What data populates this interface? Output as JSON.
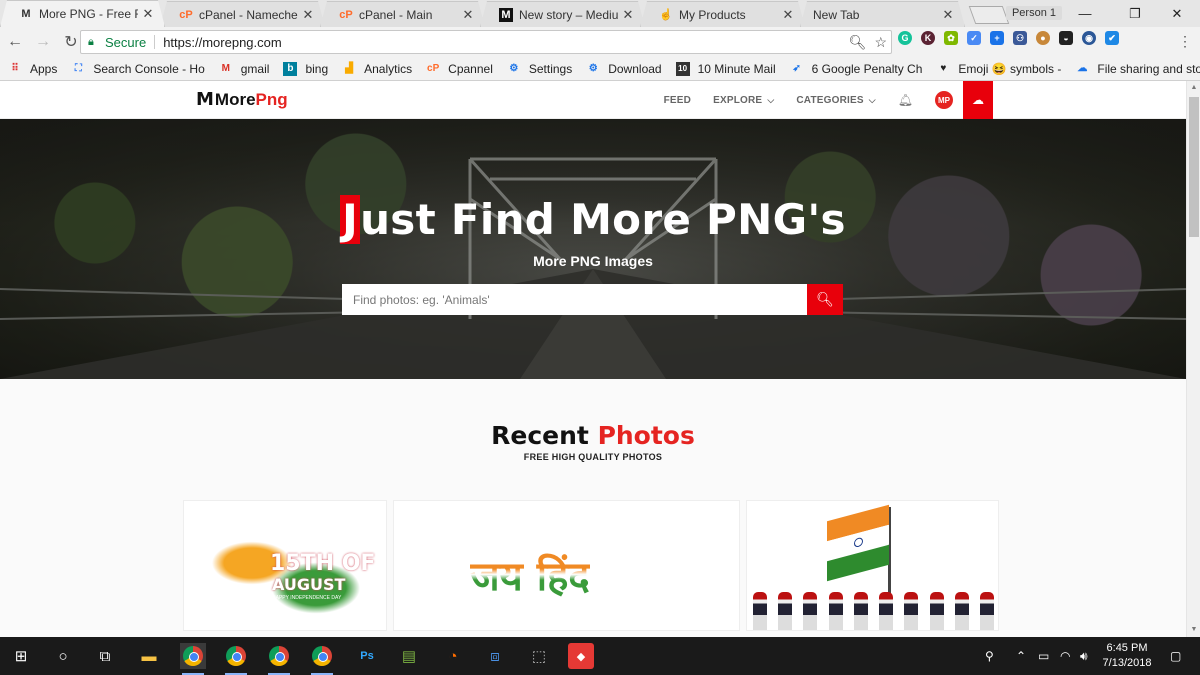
{
  "browser": {
    "tabs": [
      {
        "title": "More PNG - Free Full H",
        "favicon": "morepng-m-icon",
        "active": true
      },
      {
        "title": "cPanel - Namecheap SS",
        "favicon": "cpanel-icon",
        "active": false
      },
      {
        "title": "cPanel - Main",
        "favicon": "cpanel-icon",
        "active": false
      },
      {
        "title": "New story – Medium",
        "favicon": "medium-icon",
        "active": false
      },
      {
        "title": "My Products",
        "favicon": "hand-icon",
        "active": false
      },
      {
        "title": "New Tab",
        "favicon": "",
        "active": false
      }
    ],
    "profile": "Person 1",
    "secure_label": "Secure",
    "url": "https://morepng.com",
    "bookmarks": [
      {
        "label": "Apps",
        "icon": "apps-grid-icon"
      },
      {
        "label": "Search Console - Ho",
        "icon": "search-console-icon"
      },
      {
        "label": "gmail",
        "icon": "gmail-icon"
      },
      {
        "label": "bing",
        "icon": "bing-icon"
      },
      {
        "label": "Analytics",
        "icon": "analytics-icon"
      },
      {
        "label": "Cpannel",
        "icon": "cpanel-icon"
      },
      {
        "label": "Settings",
        "icon": "gear-icon"
      },
      {
        "label": "Download",
        "icon": "gear-icon"
      },
      {
        "label": "10 Minute Mail",
        "icon": "ten-minute-mail-icon"
      },
      {
        "label": "6 Google Penalty Ch",
        "icon": "rocket-icon"
      },
      {
        "label": "Emoji 😆 symbols - ",
        "icon": "heart-icon"
      },
      {
        "label": "File sharing and stor",
        "icon": "cloud-icon"
      }
    ]
  },
  "site": {
    "logo_part1": "More ",
    "logo_part2": "Png",
    "nav": {
      "feed": "FEED",
      "explore": "EXPLORE",
      "categories": "CATEGORIES"
    },
    "avatar_initials": "MP",
    "hero": {
      "title_first": "J",
      "title_rest": "ust Find More PNG's",
      "subtitle": "More PNG Images",
      "search_placeholder": "Find photos: eg. 'Animals'"
    },
    "recent": {
      "title_a": "Recent ",
      "title_b": "Photos",
      "subtitle": "FREE HIGH QUALITY PHOTOS",
      "card1_line1": "15TH OF",
      "card1_line2": "AUGUST",
      "card1_line3": "HAPPY INDEPENDENCE DAY",
      "card2_text": "जय हिंद"
    }
  },
  "taskbar": {
    "time": "6:45 PM",
    "date": "7/13/2018"
  },
  "colors": {
    "brand_red": "#e8000b",
    "secure_green": "#0b8043"
  }
}
